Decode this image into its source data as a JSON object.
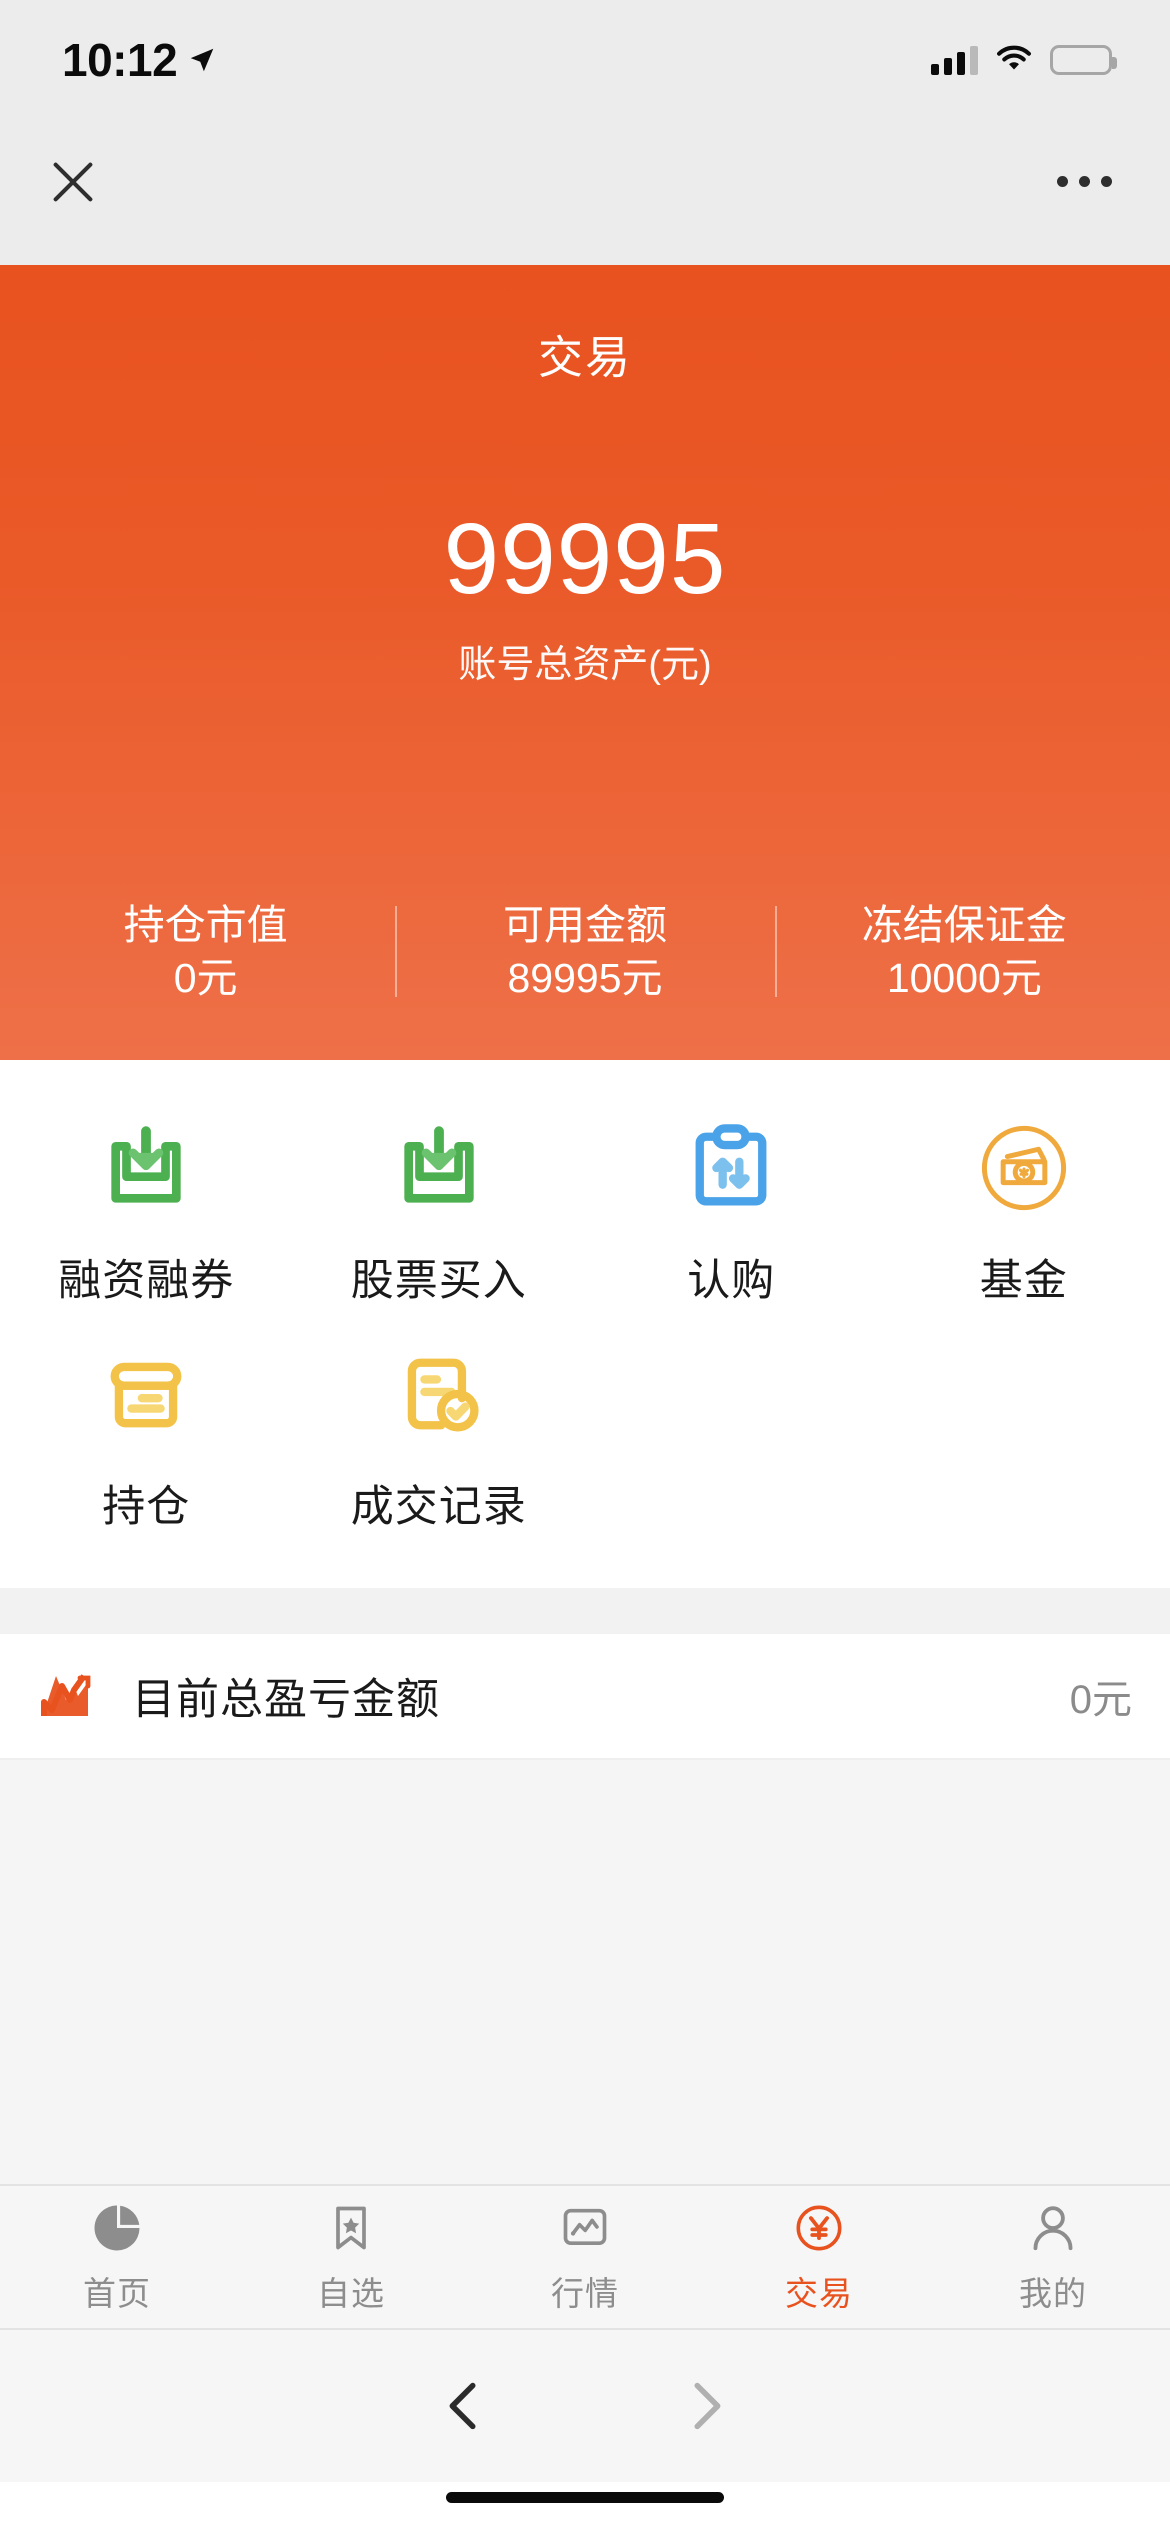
{
  "status_bar": {
    "time": "10:12",
    "location_icon": "location-arrow-icon",
    "signal_icon": "cellular-signal-icon",
    "wifi_icon": "wifi-icon",
    "battery_icon": "battery-icon"
  },
  "web_nav": {
    "close_icon": "close-icon",
    "more_icon": "more-options-icon"
  },
  "header": {
    "title": "交易",
    "total_assets": "99995",
    "total_assets_label": "账号总资产(元)",
    "stats": [
      {
        "label": "持仓市值",
        "value": "0元"
      },
      {
        "label": "可用金额",
        "value": "89995元"
      },
      {
        "label": "冻结保证金",
        "value": "10000元"
      }
    ]
  },
  "menu": {
    "items": [
      {
        "label": "融资融券",
        "icon": "inbox-download-icon",
        "color": "#4caf50"
      },
      {
        "label": "股票买入",
        "icon": "inbox-download-icon",
        "color": "#4caf50"
      },
      {
        "label": "认购",
        "icon": "clipboard-arrows-icon",
        "color": "#4aa3e8"
      },
      {
        "label": "基金",
        "icon": "money-circle-icon",
        "color": "#f0a93c"
      },
      {
        "label": "持仓",
        "icon": "card-box-icon",
        "color": "#f3c349"
      },
      {
        "label": "成交记录",
        "icon": "document-check-icon",
        "color": "#f3c349"
      }
    ]
  },
  "pnl": {
    "icon": "trend-chart-icon",
    "label": "目前总盈亏金额",
    "value": "0元"
  },
  "tab_bar": {
    "items": [
      {
        "label": "首页",
        "icon": "pie-chart-icon",
        "active": false
      },
      {
        "label": "自选",
        "icon": "bookmark-star-icon",
        "active": false
      },
      {
        "label": "行情",
        "icon": "chart-box-icon",
        "active": false
      },
      {
        "label": "交易",
        "icon": "yuan-circle-icon",
        "active": true
      },
      {
        "label": "我的",
        "icon": "person-icon",
        "active": false
      }
    ]
  },
  "browser_bar": {
    "back_icon": "chevron-left-icon",
    "forward_icon": "chevron-right-icon"
  },
  "colors": {
    "brand_orange": "#e8521f",
    "header_gradient_end": "#ee7048",
    "green": "#4caf50",
    "blue": "#4aa3e8",
    "yellow": "#f3c349",
    "orange_light": "#f0a93c",
    "muted_text": "#8d8d8d"
  }
}
